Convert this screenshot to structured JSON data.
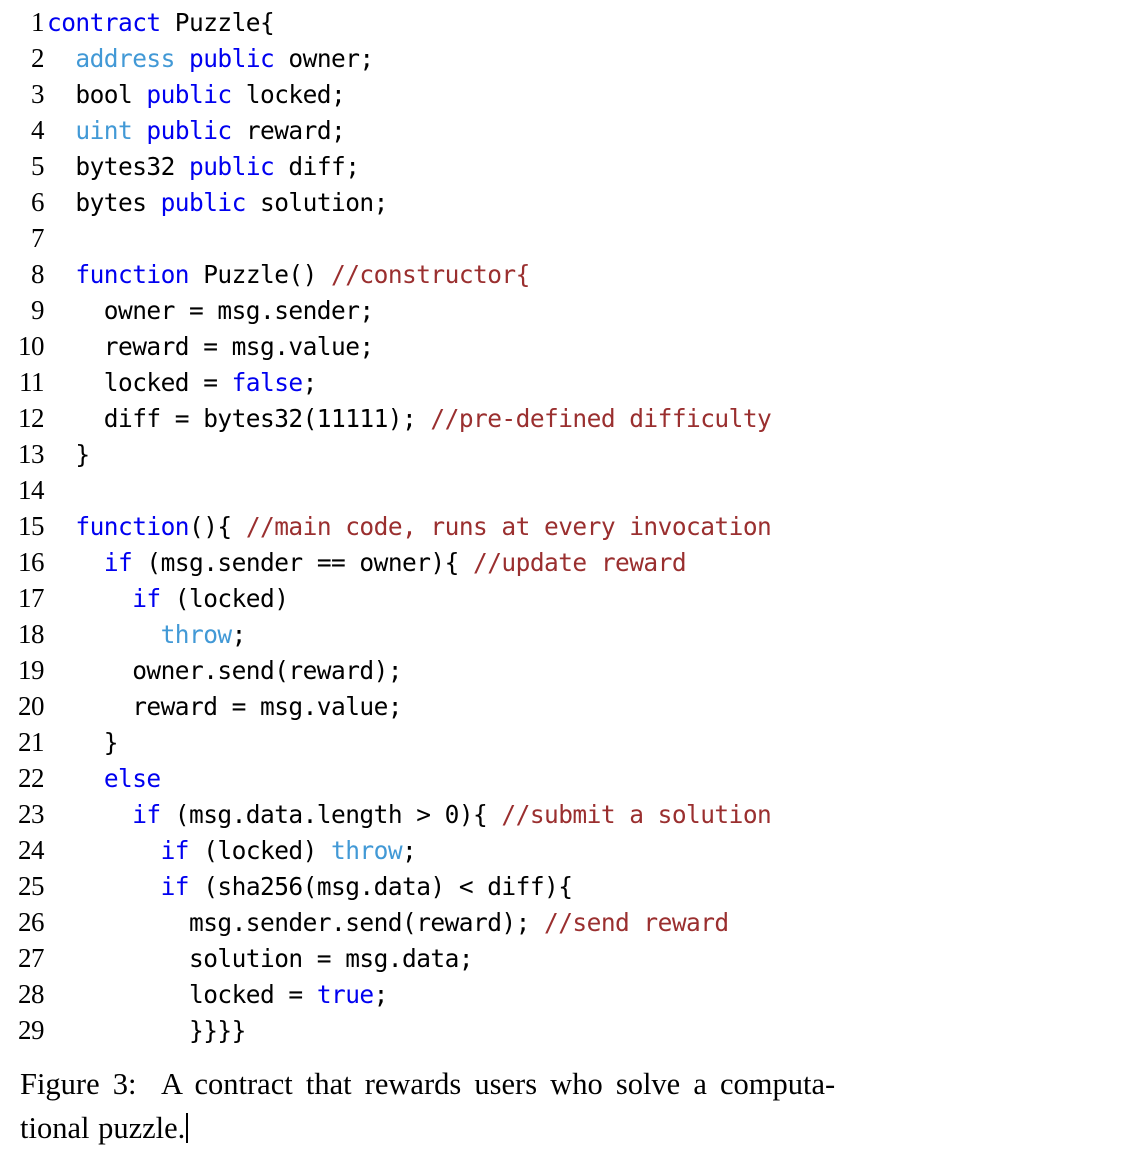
{
  "figure": {
    "caption_label": "Figure 3:",
    "caption_text": "A contract that rewards users who solve a computational puzzle.",
    "caption_line_1": "Figure 3:  A contract that rewards users who solve a computa-",
    "caption_line_2": "tional puzzle.",
    "cursor_visible": true
  },
  "colors": {
    "keyword": "#0000f0",
    "type": "#4299d6",
    "comment": "#9a2f2f",
    "plain": "#000000",
    "background": "#ffffff"
  },
  "code": {
    "language": "solidity",
    "first_line_number": 1,
    "last_line_number": 29,
    "lines": [
      {
        "n": "1",
        "tokens": [
          {
            "t": "contract",
            "c": "kw"
          },
          {
            "t": " Puzzle{",
            "c": "plain"
          }
        ]
      },
      {
        "n": "2",
        "tokens": [
          {
            "t": "  ",
            "c": "plain"
          },
          {
            "t": "address",
            "c": "type"
          },
          {
            "t": " ",
            "c": "plain"
          },
          {
            "t": "public",
            "c": "kw"
          },
          {
            "t": " owner;",
            "c": "plain"
          }
        ]
      },
      {
        "n": "3",
        "tokens": [
          {
            "t": "  bool ",
            "c": "plain"
          },
          {
            "t": "public",
            "c": "kw"
          },
          {
            "t": " locked;",
            "c": "plain"
          }
        ]
      },
      {
        "n": "4",
        "tokens": [
          {
            "t": "  ",
            "c": "plain"
          },
          {
            "t": "uint",
            "c": "type"
          },
          {
            "t": " ",
            "c": "plain"
          },
          {
            "t": "public",
            "c": "kw"
          },
          {
            "t": " reward;",
            "c": "plain"
          }
        ]
      },
      {
        "n": "5",
        "tokens": [
          {
            "t": "  bytes32 ",
            "c": "plain"
          },
          {
            "t": "public",
            "c": "kw"
          },
          {
            "t": " diff;",
            "c": "plain"
          }
        ]
      },
      {
        "n": "6",
        "tokens": [
          {
            "t": "  bytes ",
            "c": "plain"
          },
          {
            "t": "public",
            "c": "kw"
          },
          {
            "t": " solution;",
            "c": "plain"
          }
        ]
      },
      {
        "n": "7",
        "tokens": [
          {
            "t": "",
            "c": "plain"
          }
        ]
      },
      {
        "n": "8",
        "tokens": [
          {
            "t": "  ",
            "c": "plain"
          },
          {
            "t": "function",
            "c": "kw"
          },
          {
            "t": " Puzzle() ",
            "c": "plain"
          },
          {
            "t": "//constructor{",
            "c": "comment"
          }
        ]
      },
      {
        "n": "9",
        "tokens": [
          {
            "t": "    owner = msg.sender;",
            "c": "plain"
          }
        ]
      },
      {
        "n": "10",
        "tokens": [
          {
            "t": "    reward = msg.value;",
            "c": "plain"
          }
        ]
      },
      {
        "n": "11",
        "tokens": [
          {
            "t": "    locked = ",
            "c": "plain"
          },
          {
            "t": "false",
            "c": "kw"
          },
          {
            "t": ";",
            "c": "plain"
          }
        ]
      },
      {
        "n": "12",
        "tokens": [
          {
            "t": "    diff = bytes32(11111); ",
            "c": "plain"
          },
          {
            "t": "//pre-defined difficulty",
            "c": "comment"
          }
        ]
      },
      {
        "n": "13",
        "tokens": [
          {
            "t": "  }",
            "c": "plain"
          }
        ]
      },
      {
        "n": "14",
        "tokens": [
          {
            "t": "",
            "c": "plain"
          }
        ]
      },
      {
        "n": "15",
        "tokens": [
          {
            "t": "  ",
            "c": "plain"
          },
          {
            "t": "function",
            "c": "kw"
          },
          {
            "t": "(){ ",
            "c": "plain"
          },
          {
            "t": "//main code, runs at every invocation",
            "c": "comment"
          }
        ]
      },
      {
        "n": "16",
        "tokens": [
          {
            "t": "    ",
            "c": "plain"
          },
          {
            "t": "if",
            "c": "kw"
          },
          {
            "t": " (msg.sender == owner){ ",
            "c": "plain"
          },
          {
            "t": "//update reward",
            "c": "comment"
          }
        ]
      },
      {
        "n": "17",
        "tokens": [
          {
            "t": "      ",
            "c": "plain"
          },
          {
            "t": "if",
            "c": "kw"
          },
          {
            "t": " (locked)",
            "c": "plain"
          }
        ]
      },
      {
        "n": "18",
        "tokens": [
          {
            "t": "        ",
            "c": "plain"
          },
          {
            "t": "throw",
            "c": "type"
          },
          {
            "t": ";",
            "c": "plain"
          }
        ]
      },
      {
        "n": "19",
        "tokens": [
          {
            "t": "      owner.send(reward);",
            "c": "plain"
          }
        ]
      },
      {
        "n": "20",
        "tokens": [
          {
            "t": "      reward = msg.value;",
            "c": "plain"
          }
        ]
      },
      {
        "n": "21",
        "tokens": [
          {
            "t": "    }",
            "c": "plain"
          }
        ]
      },
      {
        "n": "22",
        "tokens": [
          {
            "t": "    ",
            "c": "plain"
          },
          {
            "t": "else",
            "c": "kw"
          }
        ]
      },
      {
        "n": "23",
        "tokens": [
          {
            "t": "      ",
            "c": "plain"
          },
          {
            "t": "if",
            "c": "kw"
          },
          {
            "t": " (msg.data.length > 0){ ",
            "c": "plain"
          },
          {
            "t": "//submit a solution",
            "c": "comment"
          }
        ]
      },
      {
        "n": "24",
        "tokens": [
          {
            "t": "        ",
            "c": "plain"
          },
          {
            "t": "if",
            "c": "kw"
          },
          {
            "t": " (locked) ",
            "c": "plain"
          },
          {
            "t": "throw",
            "c": "type"
          },
          {
            "t": ";",
            "c": "plain"
          }
        ]
      },
      {
        "n": "25",
        "tokens": [
          {
            "t": "        ",
            "c": "plain"
          },
          {
            "t": "if",
            "c": "kw"
          },
          {
            "t": " (sha256(msg.data) < diff){",
            "c": "plain"
          }
        ]
      },
      {
        "n": "26",
        "tokens": [
          {
            "t": "          msg.sender.send(reward); ",
            "c": "plain"
          },
          {
            "t": "//send reward",
            "c": "comment"
          }
        ]
      },
      {
        "n": "27",
        "tokens": [
          {
            "t": "          solution = msg.data;",
            "c": "plain"
          }
        ]
      },
      {
        "n": "28",
        "tokens": [
          {
            "t": "          locked = ",
            "c": "plain"
          },
          {
            "t": "true",
            "c": "kw"
          },
          {
            "t": ";",
            "c": "plain"
          }
        ]
      },
      {
        "n": "29",
        "tokens": [
          {
            "t": "          }}}}",
            "c": "plain"
          }
        ]
      }
    ]
  }
}
